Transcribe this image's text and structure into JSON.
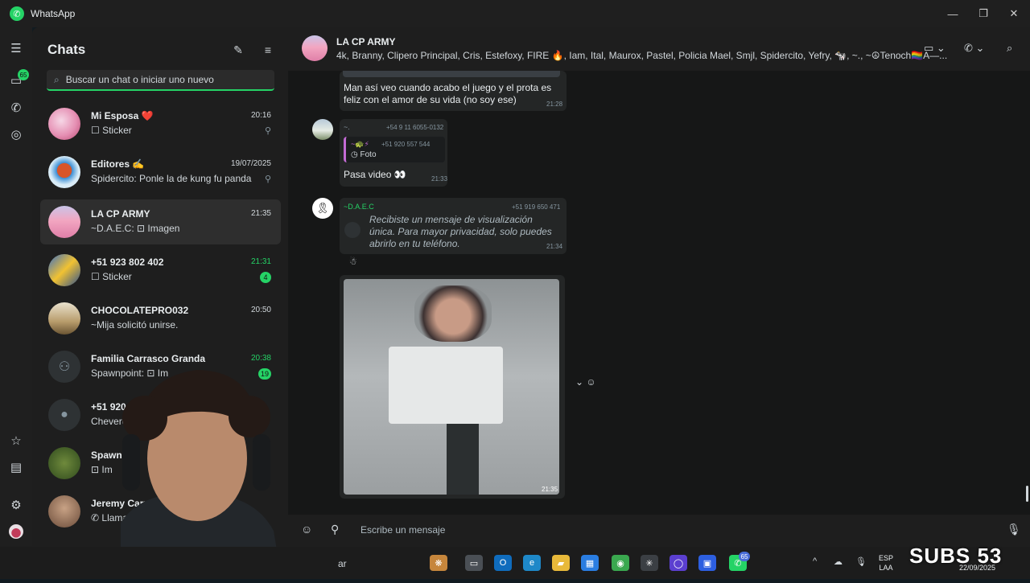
{
  "app": {
    "title": "WhatsApp"
  },
  "sidebar": {
    "title": "Chats",
    "search_placeholder": "Buscar un chat o iniciar uno nuevo",
    "rail_badge": "65",
    "chats": [
      {
        "name": "Mi Esposa ❤️",
        "preview": "☐ Sticker",
        "time": "20:16",
        "pinned": true
      },
      {
        "name": "Editores ✍️",
        "preview": "Spidercito: Ponle la de kung fu panda",
        "time": "19/07/2025",
        "pinned": true
      },
      {
        "name": "LA CP ARMY",
        "preview": "~D.A.E.C: ⊡ Imagen",
        "time": "21:35",
        "active": true
      },
      {
        "name": "+51 923 802 402",
        "preview": "☐ Sticker",
        "time": "21:31",
        "unread": "4"
      },
      {
        "name": "CHOCOLATEPRO032",
        "preview": "~Mija solicitó unirse.",
        "time": "20:50"
      },
      {
        "name": "Familia Carrasco Granda",
        "preview": "Spawnpoint: ⊡ Im",
        "time": "20:38",
        "unread": "19"
      },
      {
        "name": "+51 920 5",
        "preview": "Chevere"
      },
      {
        "name": "Spawn",
        "preview": "⊡ Im"
      },
      {
        "name": "Jeremy Carr",
        "preview": "✆ Llamad"
      }
    ]
  },
  "chat": {
    "title": "LA CP ARMY",
    "members": "4k, Branny, Clipero Principal, Cris, Estefoxy, FIRE 🔥, Iam, Ital, Maurox, Pastel, Policia Mael, Smjl, Spidercito, Yefry, 🐄, ~., ~☮Tenoch🏳️‍🌈A—..."
  },
  "messages": {
    "m1_text": "Man así veo cuando acabo el juego y el prota es feliz con el amor de su vida (no soy ese)",
    "m1_time": "21:28",
    "m2_sender": "~.",
    "m2_phone": "+54 9 11 6055-0132",
    "m2_quote_sender": "~🐢⚡",
    "m2_quote_phone": "+51 920 557 544",
    "m2_quote_text": "Foto",
    "m2_text": "Pasa video 👀",
    "m2_time": "21:33",
    "m3_sender": "~D.A.E.C",
    "m3_phone": "+51 919 650 471",
    "m3_text": "Recibiste un mensaje de visualización única. Para mayor privacidad, solo puedes abrirlo en tu teléfono.",
    "m3_time": "21:34",
    "m4_time": "21:35"
  },
  "input": {
    "placeholder": "Escribe un mensaje"
  },
  "taskbar": {
    "search_text": "ar",
    "lang_top": "ESP",
    "lang_bottom": "LAA",
    "date": "22/09/2025",
    "overlay_text": "SUBS 53",
    "whatsapp_badge": "65"
  },
  "colors": {
    "accent": "#25d366",
    "panel": "#1e1e1e",
    "chat_bg": "#161717",
    "bubble": "#242626"
  }
}
